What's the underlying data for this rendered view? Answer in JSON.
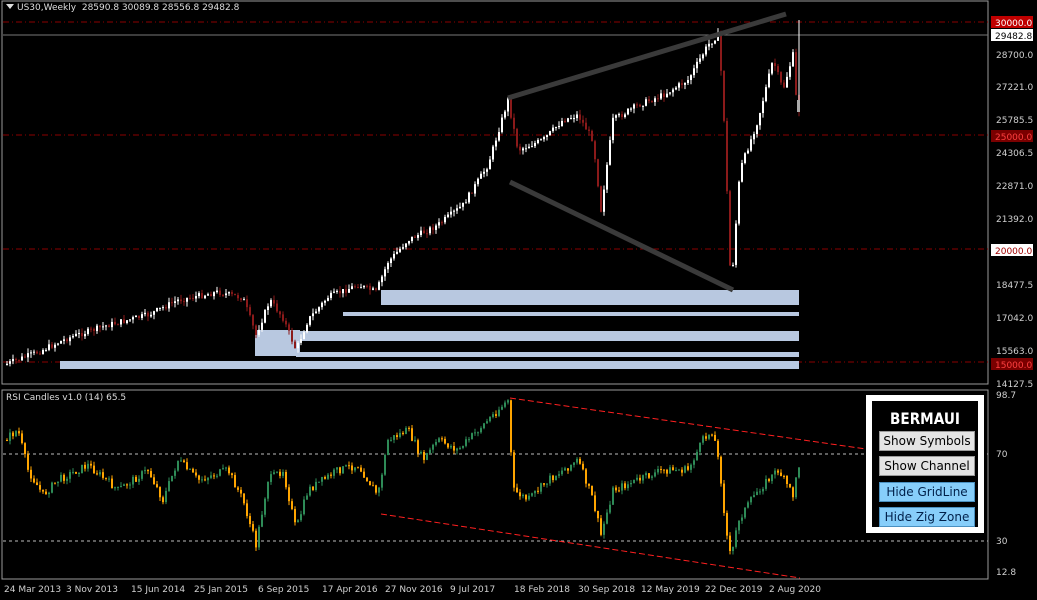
{
  "header": {
    "symbol": "US30,Weekly",
    "ohlc": "28590.8 30089.8 28556.8 29482.8"
  },
  "price_axis": {
    "labels": [
      "28700.0",
      "27221.0",
      "25785.5",
      "24306.5",
      "22871.0",
      "21392.0",
      "18477.5",
      "17042.0",
      "15563.0",
      "14127.5"
    ],
    "current_price": "29482.8",
    "levels": [
      "30000.0",
      "25000.0",
      "20000.0",
      "15000.0"
    ]
  },
  "rsi": {
    "title": "RSI Candles v1.0 (14) 65.5",
    "axis_labels": [
      "98.7",
      "70",
      "30",
      "12.8"
    ]
  },
  "time_axis": [
    "24 Mar 2013",
    "3 Nov 2013",
    "15 Jun 2014",
    "25 Jan 2015",
    "6 Sep 2015",
    "17 Apr 2016",
    "27 Nov 2016",
    "9 Jul 2017",
    "18 Feb 2018",
    "30 Sep 2018",
    "12 May 2019",
    "22 Dec 2019",
    "2 Aug 2020"
  ],
  "panel": {
    "title": "BERMAUI",
    "buttons": [
      "Show Symbols",
      "Show Channel",
      "Hide GridLine",
      "Hide Zig Zone"
    ]
  },
  "colors": {
    "bull": "#ffffff",
    "bear": "#8b1a1a",
    "level": "#8b0000",
    "zone": "#b8c8e0",
    "rsi_up": "#2e8b57",
    "rsi_down": "#ffa500",
    "rsi_channel": "#ff2020"
  }
}
